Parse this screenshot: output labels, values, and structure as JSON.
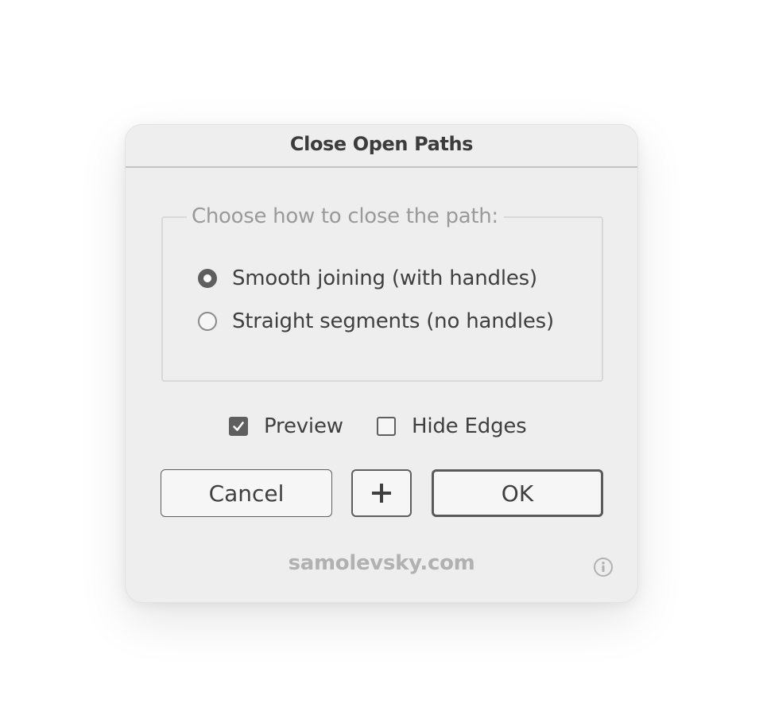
{
  "dialog": {
    "title": "Close Open Paths",
    "group_label": "Choose how to close the path:",
    "options": [
      {
        "label": "Smooth joining (with handles)",
        "selected": true
      },
      {
        "label": "Straight segments (no handles)",
        "selected": false
      }
    ],
    "checkboxes": [
      {
        "label": "Preview",
        "checked": true
      },
      {
        "label": "Hide Edges",
        "checked": false
      }
    ],
    "buttons": {
      "cancel_label": "Cancel",
      "add_label": "+",
      "ok_label": "OK"
    },
    "footer_text": "samolevsky.com",
    "icons": {
      "info": "info-icon",
      "checkmark": "checkmark-icon"
    }
  },
  "colors": {
    "dialog_background": "#eeeeee",
    "control_dark": "#5f5f5f",
    "text": "#3f3f3f",
    "muted_text": "#9a9a9a"
  }
}
